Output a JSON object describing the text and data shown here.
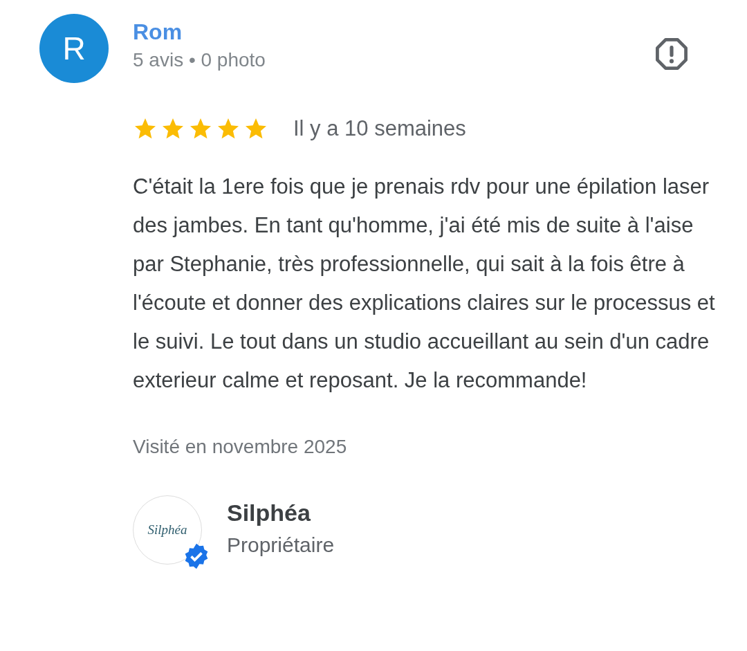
{
  "review": {
    "avatar_letter": "R",
    "author": "Rom",
    "author_stats": "5 avis • 0 photo",
    "stars": 5,
    "date": "Il y a 10 semaines",
    "text": "C'était la 1ere fois que je prenais rdv pour une épilation laser des jambes. En tant qu'homme, j'ai été mis de suite à l'aise par Stephanie, très professionnelle, qui sait à la fois être à l'écoute et donner des explications claires sur le processus et le suivi. Le tout dans un studio accueillant au sein d'un cadre exterieur calme et reposant. Je la recommande!",
    "visited": "Visité en novembre 2025"
  },
  "owner": {
    "logo_text": "Silphéa",
    "name": "Silphéa",
    "role": "Propriétaire",
    "verified": true
  }
}
